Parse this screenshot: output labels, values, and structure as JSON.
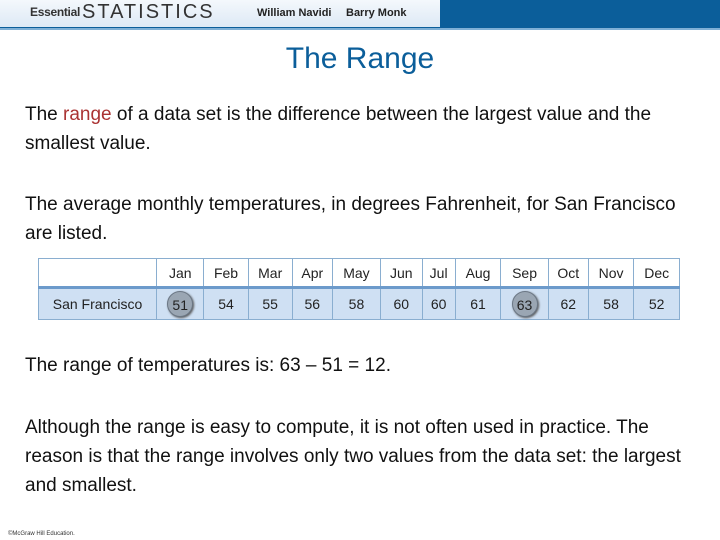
{
  "header": {
    "brand_small": "Essential",
    "brand_large": "STATISTICS",
    "authors": [
      "William Navidi",
      "Barry Monk"
    ]
  },
  "title": "The Range",
  "para1": {
    "before": "The ",
    "term": "range",
    "after": " of a data set is the difference between the largest value and the smallest value."
  },
  "para2": "The average monthly temperatures, in degrees Fahrenheit, for San Francisco are listed.",
  "table": {
    "months": [
      "Jan",
      "Feb",
      "Mar",
      "Apr",
      "May",
      "Jun",
      "Jul",
      "Aug",
      "Sep",
      "Oct",
      "Nov",
      "Dec"
    ],
    "row_label": "San Francisco",
    "values": [
      "51",
      "54",
      "55",
      "56",
      "58",
      "60",
      "60",
      "61",
      "63",
      "62",
      "58",
      "52"
    ],
    "circled": [
      0,
      8
    ]
  },
  "para3": "The range of temperatures is: 63 – 51 = 12.",
  "para4": "Although the range is easy to compute, it is not often used in practice. The reason is that the range involves only two values from the data set: the largest and smallest.",
  "footer": "©McGraw Hill Education.",
  "colors": {
    "title": "#0b5e9a",
    "term": "#aa3333",
    "bar": "#0b5e9a"
  }
}
